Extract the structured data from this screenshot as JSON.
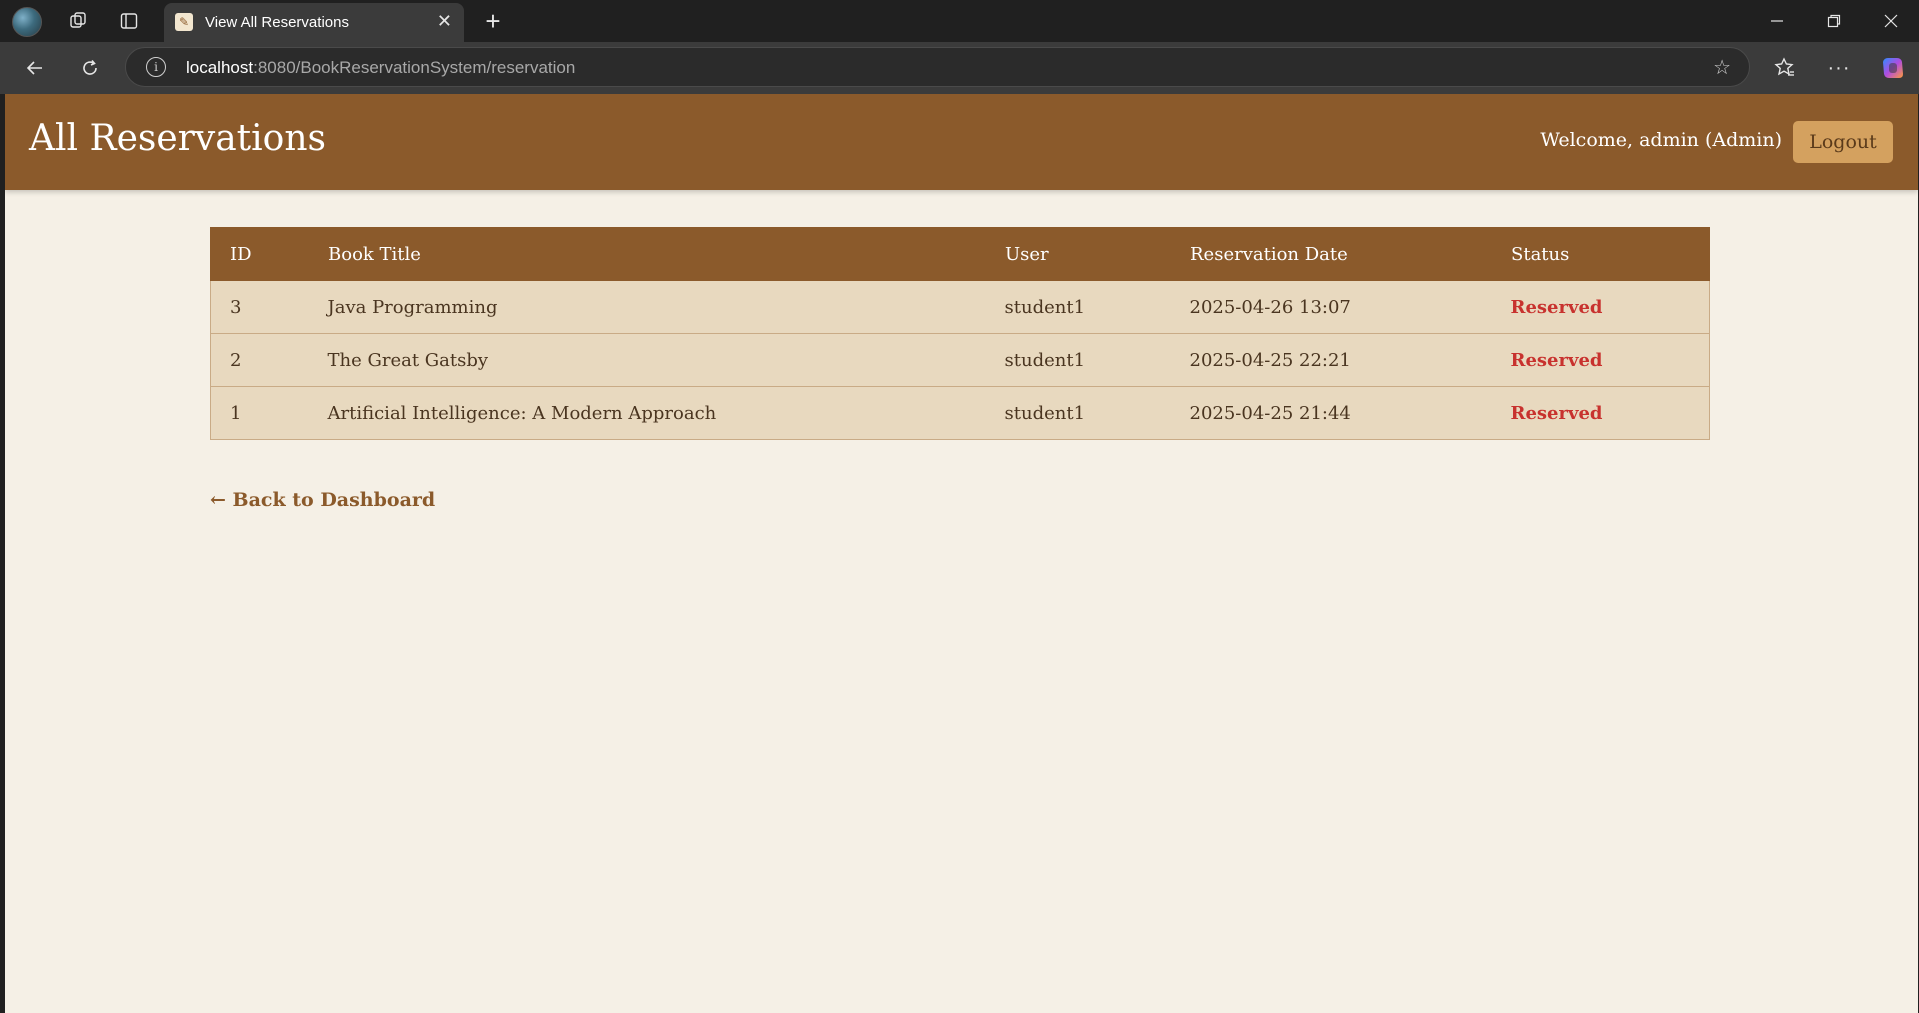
{
  "browser": {
    "tab_title": "View All Reservations",
    "address_host": "localhost",
    "address_rest": ":8080/BookReservationSystem/reservation"
  },
  "header": {
    "title": "All Reservations",
    "welcome": "Welcome, admin (Admin)",
    "logout_label": "Logout"
  },
  "table": {
    "columns": [
      "ID",
      "Book Title",
      "User",
      "Reservation Date",
      "Status"
    ],
    "rows": [
      {
        "id": "3",
        "title": "Java Programming",
        "user": "student1",
        "date": "2025-04-26 13:07",
        "status": "Reserved"
      },
      {
        "id": "2",
        "title": "The Great Gatsby",
        "user": "student1",
        "date": "2025-04-25 22:21",
        "status": "Reserved"
      },
      {
        "id": "1",
        "title": "Artificial Intelligence: A Modern Approach",
        "user": "student1",
        "date": "2025-04-25 21:44",
        "status": "Reserved"
      }
    ]
  },
  "back_link": "← Back to Dashboard",
  "colors": {
    "header_brown": "#8b5a2b",
    "page_bg": "#f5f0e6",
    "row_bg": "#e8d9bf",
    "status_red": "#c8322e",
    "logout_bg": "#d4a15f"
  }
}
